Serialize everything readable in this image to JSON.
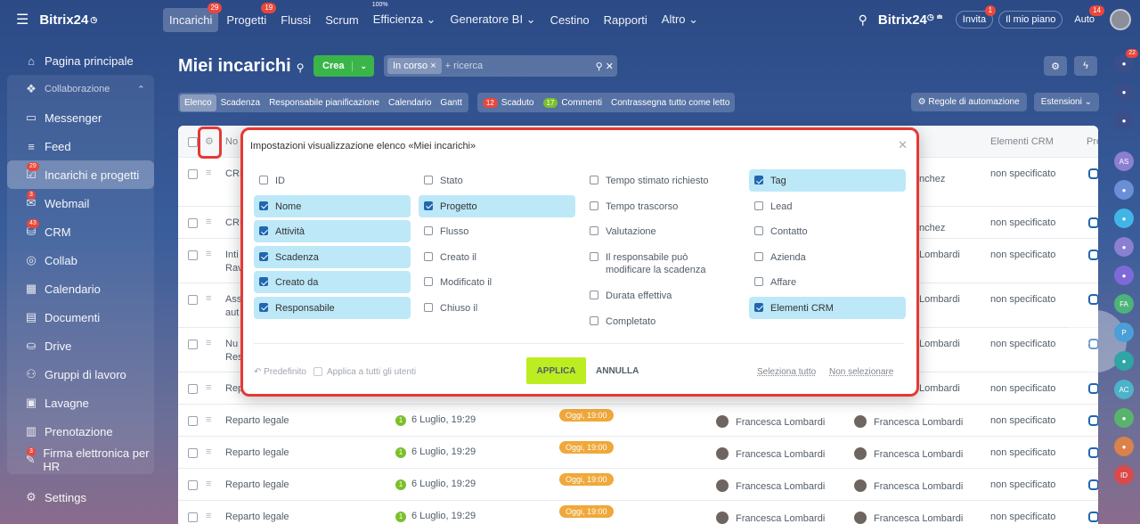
{
  "topbar": {
    "brand": "Bitrix24",
    "nav": [
      {
        "label": "Incarichi",
        "count": "29",
        "active": true
      },
      {
        "label": "Progetti",
        "count": "19"
      },
      {
        "label": "Flussi"
      },
      {
        "label": "Scrum"
      },
      {
        "label": "Efficienza",
        "sup": "100%",
        "caret": true
      },
      {
        "label": "Generatore BI",
        "caret": true
      },
      {
        "label": "Cestino"
      },
      {
        "label": "Rapporti"
      },
      {
        "label": "Altro",
        "caret": true
      }
    ],
    "logo_right": "Bitrix24",
    "invite": {
      "label": "Invita",
      "count": "1"
    },
    "plan": "Il mio piano",
    "auto": {
      "label": "Auto",
      "count": "14"
    }
  },
  "sidebar": {
    "items": [
      {
        "label": "Pagina principale",
        "icon": "home-icon"
      },
      {
        "label": "Collaborazione",
        "icon": "collab-icon",
        "group": true
      },
      {
        "label": "Messenger",
        "icon": "chat-icon"
      },
      {
        "label": "Feed",
        "icon": "feed-icon"
      },
      {
        "label": "Incarichi e progetti",
        "icon": "tasks-icon",
        "count": "29",
        "active": true
      },
      {
        "label": "Webmail",
        "icon": "mail-icon",
        "count": "3"
      },
      {
        "label": "CRM",
        "icon": "crm-icon",
        "count": "43"
      },
      {
        "label": "Collab",
        "icon": "collab2-icon"
      },
      {
        "label": "Calendario",
        "icon": "calendar-icon"
      },
      {
        "label": "Documenti",
        "icon": "docs-icon"
      },
      {
        "label": "Drive",
        "icon": "drive-icon"
      },
      {
        "label": "Gruppi di lavoro",
        "icon": "groups-icon"
      },
      {
        "label": "Lavagne",
        "icon": "boards-icon"
      },
      {
        "label": "Prenotazione",
        "icon": "booking-icon"
      },
      {
        "label": "Firma elettronica per HR",
        "icon": "sign-icon",
        "count": "3"
      },
      {
        "label": "Settings",
        "icon": "settings-icon"
      }
    ]
  },
  "page": {
    "title": "Miei incarichi",
    "create_label": "Crea",
    "filter_chip": "In corso",
    "filter_placeholder": "+ ricerca"
  },
  "toolbar": {
    "tabs": [
      "Elenco",
      "Scadenza",
      "Responsabile pianificazione",
      "Calendario",
      "Gantt"
    ],
    "overdue_count": "12",
    "overdue_label": "Scaduto",
    "comments_count": "17",
    "comments_label": "Commenti",
    "mark_all": "Contrassegna tutto come letto",
    "automation": "Regole di automazione",
    "extensions": "Estensioni"
  },
  "grid": {
    "header_name": "No",
    "header_crm": "Elementi CRM",
    "header_pro": "Pro",
    "rows": [
      {
        "name": "CRI",
        "person1": "",
        "person2": "nchez",
        "crm": "non specificato"
      },
      {
        "name": "CRI",
        "person1": "",
        "person2": "nchez",
        "crm": "non specificato"
      },
      {
        "name": "Inti",
        "name2": "Rav",
        "person2": "Lombardi",
        "crm": "non specificato"
      },
      {
        "name": "Ass",
        "name2": "aut",
        "person2": "Lombardi",
        "crm": "non specificato"
      },
      {
        "name": "Nu",
        "name2": "Res",
        "person2": "Lombardi",
        "crm": "non specificato"
      },
      {
        "name": "Rep",
        "person2": "Lombardi",
        "crm": "non specificato"
      },
      {
        "name": "Reparto legale",
        "date": "6 Luglio, 19:29",
        "deadline": "Oggi, 19:00",
        "person1": "Francesca Lombardi",
        "person2": "Francesca Lombardi",
        "crm": "non specificato"
      },
      {
        "name": "Reparto legale",
        "date": "6 Luglio, 19:29",
        "deadline": "Oggi, 19:00",
        "person1": "Francesca Lombardi",
        "person2": "Francesca Lombardi",
        "crm": "non specificato"
      },
      {
        "name": "Reparto legale",
        "date": "6 Luglio, 19:29",
        "deadline": "Oggi, 19:00",
        "person1": "Francesca Lombardi",
        "person2": "Francesca Lombardi",
        "crm": "non specificato"
      },
      {
        "name": "Reparto legale",
        "date": "6 Luglio, 19:29",
        "deadline": "Oggi, 19:00",
        "person1": "Francesca Lombardi",
        "person2": "Francesca Lombardi",
        "crm": "non specificato"
      }
    ]
  },
  "right_bar": [
    {
      "label": "",
      "color": "#3a4f8a",
      "count": "22"
    },
    {
      "label": "",
      "color": "#3a4f8a"
    },
    {
      "label": "",
      "color": "#3a4f8a"
    },
    {
      "label": "AS",
      "color": "#8a7fd1"
    },
    {
      "label": "",
      "color": "#6b8fd6"
    },
    {
      "label": "",
      "color": "#41b6e6"
    },
    {
      "label": "",
      "color": "#8a7fd1"
    },
    {
      "label": "",
      "color": "#7d6ad8"
    },
    {
      "label": "FA",
      "color": "#4cb37a"
    },
    {
      "label": "P",
      "color": "#4a9fd8"
    },
    {
      "label": "",
      "color": "#2fa5a5"
    },
    {
      "label": "AC",
      "color": "#4cb3c9"
    },
    {
      "label": "",
      "color": "#59b36d"
    },
    {
      "label": "",
      "color": "#d9824a"
    },
    {
      "label": "ID",
      "color": "#d94a4a"
    }
  ],
  "modal": {
    "title": "Impostazioni visualizzazione elenco «Miei incarichi»",
    "columns": [
      [
        {
          "label": "ID",
          "checked": false
        },
        {
          "label": "Nome",
          "checked": true
        },
        {
          "label": "Attività",
          "checked": true
        },
        {
          "label": "Scadenza",
          "checked": true
        },
        {
          "label": "Creato da",
          "checked": true
        },
        {
          "label": "Responsabile",
          "checked": true
        }
      ],
      [
        {
          "label": "Stato",
          "checked": false
        },
        {
          "label": "Progetto",
          "checked": true
        },
        {
          "label": "Flusso",
          "checked": false
        },
        {
          "label": "Creato il",
          "checked": false
        },
        {
          "label": "Modificato il",
          "checked": false
        },
        {
          "label": "Chiuso il",
          "checked": false
        }
      ],
      [
        {
          "label": "Tempo stimato richiesto",
          "checked": false
        },
        {
          "label": "Tempo trascorso",
          "checked": false
        },
        {
          "label": "Valutazione",
          "checked": false
        },
        {
          "label": "Il responsabile può modificare la scadenza",
          "checked": false,
          "tall": true
        },
        {
          "label": "Durata effettiva",
          "checked": false
        },
        {
          "label": "Completato",
          "checked": false
        }
      ],
      [
        {
          "label": "Tag",
          "checked": true
        },
        {
          "label": "Lead",
          "checked": false
        },
        {
          "label": "Contatto",
          "checked": false
        },
        {
          "label": "Azienda",
          "checked": false
        },
        {
          "label": "Affare",
          "checked": false
        },
        {
          "label": "Elementi CRM",
          "checked": true
        }
      ]
    ],
    "default_label": "Predefinito",
    "apply_all_label": "Applica a tutti gli utenti",
    "apply_button": "APPLICA",
    "cancel_button": "ANNULLA",
    "select_all": "Seleziona tutto",
    "deselect": "Non selezionare"
  }
}
